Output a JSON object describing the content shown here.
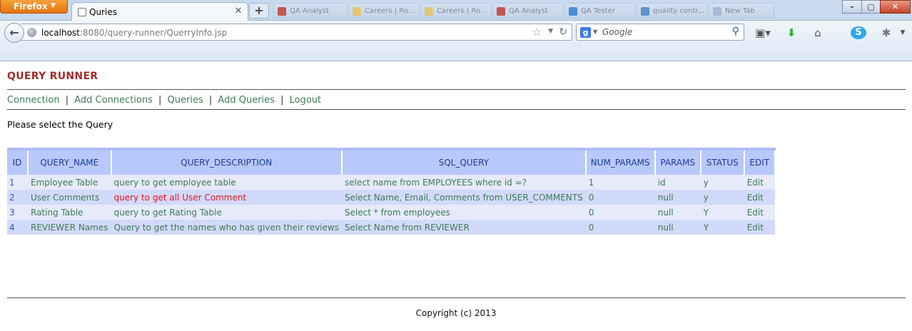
{
  "browser": {
    "firefox_label": "Firefox",
    "active_tab_title": "Quries",
    "background_tabs": [
      "QA Analyst",
      "Careers | Ro...",
      "Careers | Ro...",
      "QA Analyst",
      "QA Tester",
      "quality contr...",
      "New Tab"
    ],
    "url_host": "localhost",
    "url_path": ":8080/query-runner/QuerryInfo.jsp",
    "search_placeholder": "Google",
    "search_engine_letter": "g"
  },
  "page": {
    "app_title": "QUERY RUNNER",
    "menu": [
      "Connection",
      "Add Connections",
      "Queries",
      "Add Queries",
      "Logout"
    ],
    "menu_separator": "|",
    "prompt": "Please select the Query",
    "table": {
      "headers": [
        "ID",
        "QUERY_NAME",
        "QUERY_DESCRIPTION",
        "SQL_QUERY",
        "NUM_PARAMS",
        "PARAMS",
        "STATUS",
        "EDIT"
      ],
      "rows": [
        [
          "1",
          "Employee Table",
          "query to get employee table",
          "select name from EMPLOYEES where id =?",
          "1",
          "id",
          "y",
          "Edit"
        ],
        [
          "2",
          "User Comments",
          "query to get all User Comment",
          "Select Name, Email, Comments from USER_COMMENTS",
          "0",
          "null",
          "y",
          "Edit"
        ],
        [
          "3",
          "Rating Table",
          "query to get Rating Table",
          "Select * from employees",
          "0",
          "null",
          "Y",
          "Edit"
        ],
        [
          "4",
          "REVIEWER Names",
          "Query to get the names who has given their reviews",
          "Select Name from REVIEWER",
          "0",
          "null",
          "Y",
          "Edit"
        ]
      ]
    },
    "copyright": "Copyright (c) 2013"
  },
  "colors": {
    "title": "#a52a2a",
    "link": "#3f7a55",
    "header_bg": "#b9c8fb",
    "header_text": "#1c3a98",
    "row_odd": "#e6eafb",
    "row_even": "#d2dafb",
    "highlight_text": "#e8151b"
  }
}
